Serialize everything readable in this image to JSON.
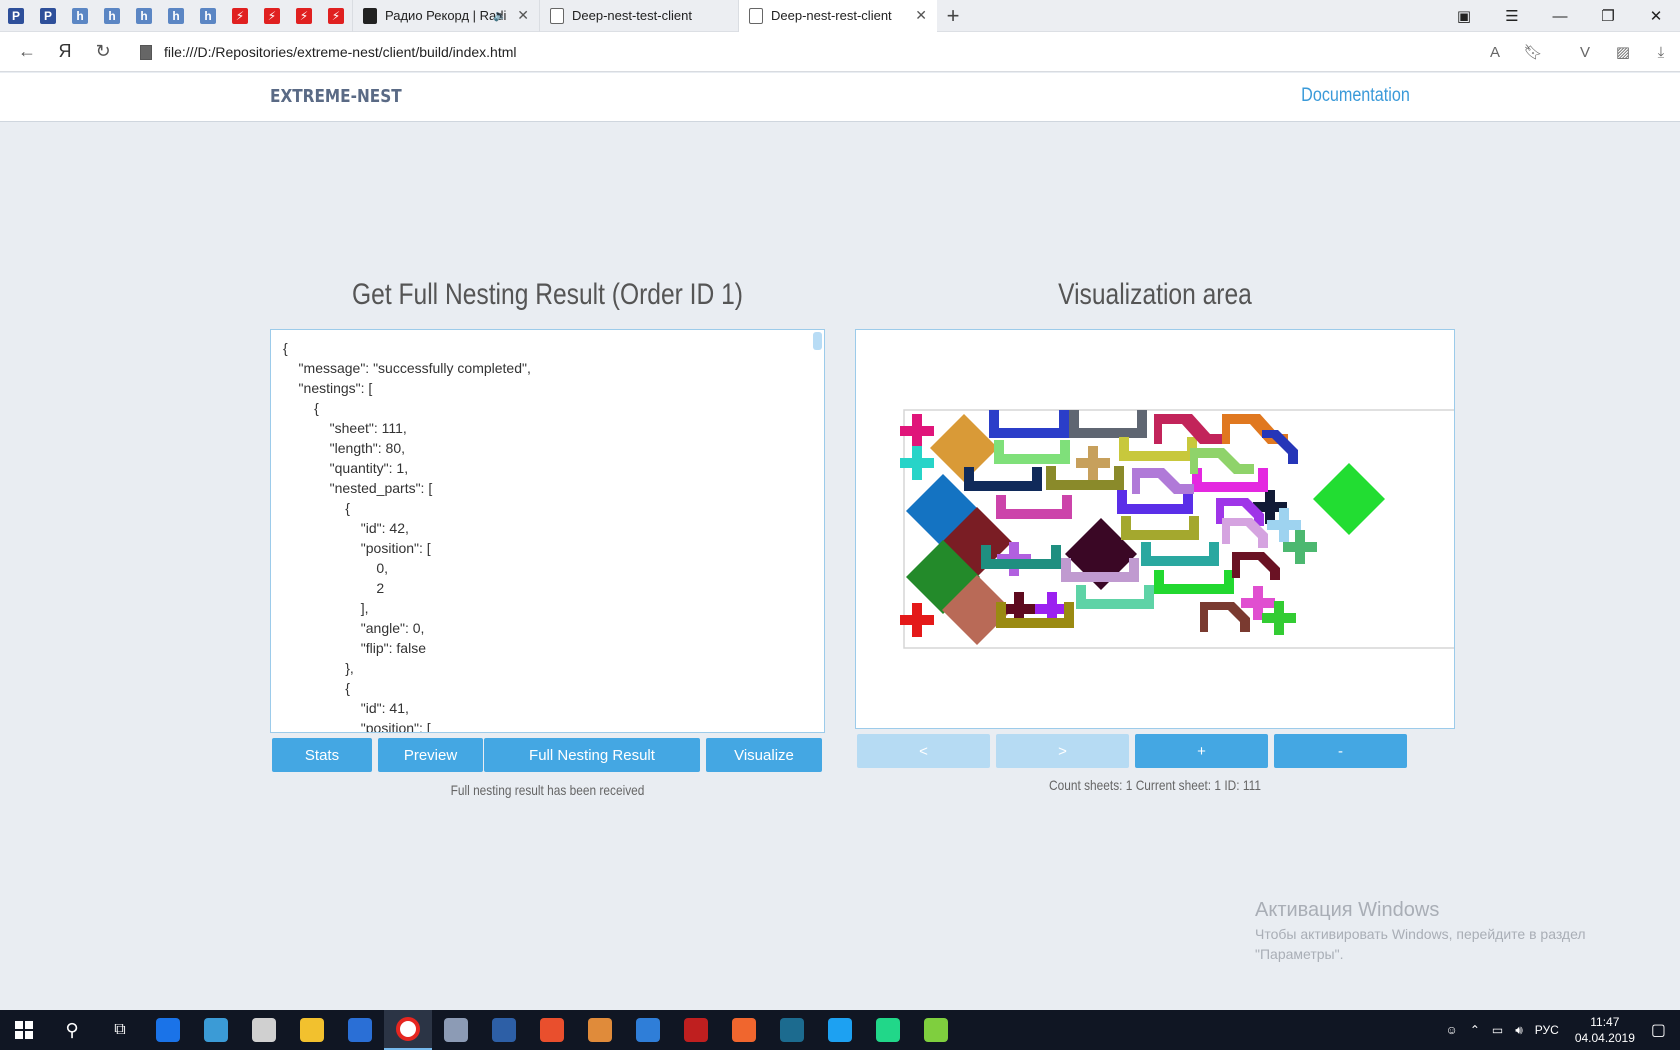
{
  "browser": {
    "pinned_tabs": [
      {
        "icon": "p-blue-icon",
        "color": "#2e4f9a",
        "glyph": "P"
      },
      {
        "icon": "p-blue-icon",
        "color": "#2e4f9a",
        "glyph": "P"
      },
      {
        "icon": "h-icon",
        "color": "#5b86c4",
        "glyph": "h"
      },
      {
        "icon": "h-icon",
        "color": "#5b86c4",
        "glyph": "h"
      },
      {
        "icon": "h-icon",
        "color": "#5b86c4",
        "glyph": "h"
      },
      {
        "icon": "h-icon",
        "color": "#5b86c4",
        "glyph": "h"
      },
      {
        "icon": "h-icon",
        "color": "#5b86c4",
        "glyph": "h"
      },
      {
        "icon": "lightning-icon",
        "color": "#e02020",
        "glyph": "⚡"
      },
      {
        "icon": "lightning-icon",
        "color": "#e02020",
        "glyph": "⚡"
      },
      {
        "icon": "lightning-icon",
        "color": "#e02020",
        "glyph": "⚡"
      },
      {
        "icon": "lightning-icon",
        "color": "#e02020",
        "glyph": "⚡"
      }
    ],
    "tabs": [
      {
        "title": "Радио Рекорд | Radi",
        "close": "✕"
      },
      {
        "title": "Deep-nest-test-client",
        "close": ""
      },
      {
        "title": "Deep-nest-rest-client",
        "close": "✕"
      }
    ],
    "new_tab": "+",
    "url": "file:///D:/Repositories/extreme-nest/client/build/index.html",
    "yandex_btn": "Я"
  },
  "header": {
    "logo": "EXTREME-NEST",
    "doc_link": "Documentation"
  },
  "left": {
    "title": "Get Full Nesting Result (Order ID 1)",
    "json_text": "{\n    \"message\": \"successfully completed\",\n    \"nestings\": [\n        {\n            \"sheet\": 111,\n            \"length\": 80,\n            \"quantity\": 1,\n            \"nested_parts\": [\n                {\n                    \"id\": 42,\n                    \"position\": [\n                        0,\n                        2\n                    ],\n                    \"angle\": 0,\n                    \"flip\": false\n                },\n                {\n                    \"id\": 41,\n                    \"position\": [",
    "buttons": {
      "stats": "Stats",
      "preview": "Preview",
      "full": "Full Nesting Result",
      "visualize": "Visualize"
    },
    "status": "Full nesting result has been received"
  },
  "right": {
    "title": "Visualization area",
    "buttons": {
      "prev": "<",
      "next": ">",
      "zoom_in": "+",
      "zoom_out": "-"
    },
    "status": "Count sheets: 1 Current sheet: 1 ID: 111"
  },
  "watermark": {
    "title": "Активация Windows",
    "line1": "Чтобы активировать Windows, перейдите в раздел",
    "line2": "\"Параметры\"."
  },
  "taskbar": {
    "apps": [
      {
        "icon": "teamviewer-icon",
        "color": "#1a73e8"
      },
      {
        "icon": "network-icon",
        "color": "#3b9bd6"
      },
      {
        "icon": "calculator-icon",
        "color": "#d0d0d0"
      },
      {
        "icon": "folder-icon",
        "color": "#f2c12e"
      },
      {
        "icon": "film-icon",
        "color": "#2a6fd6"
      },
      {
        "icon": "yandex-browser-icon",
        "color": "#e8e8e8"
      },
      {
        "icon": "app-icon",
        "color": "#8c9bb5"
      },
      {
        "icon": "powershell-icon",
        "color": "#2d5fa6"
      },
      {
        "icon": "color-wheel-icon",
        "color": "#e94f2d"
      },
      {
        "icon": "spiral-icon",
        "color": "#e08b3a"
      },
      {
        "icon": "shark-icon",
        "color": "#2f7ed8"
      },
      {
        "icon": "filezilla-icon",
        "color": "#bf1f1f"
      },
      {
        "icon": "compass-icon",
        "color": "#f0662e"
      },
      {
        "icon": "globe-icon",
        "color": "#1c6b8f"
      },
      {
        "icon": "skype-icon",
        "color": "#1da1f2"
      },
      {
        "icon": "webstorm-icon",
        "color": "#21d789"
      },
      {
        "icon": "chart-app-icon",
        "color": "#7fcf3e"
      }
    ],
    "lang": "РУС",
    "time": "11:47",
    "date": "04.04.2019"
  }
}
